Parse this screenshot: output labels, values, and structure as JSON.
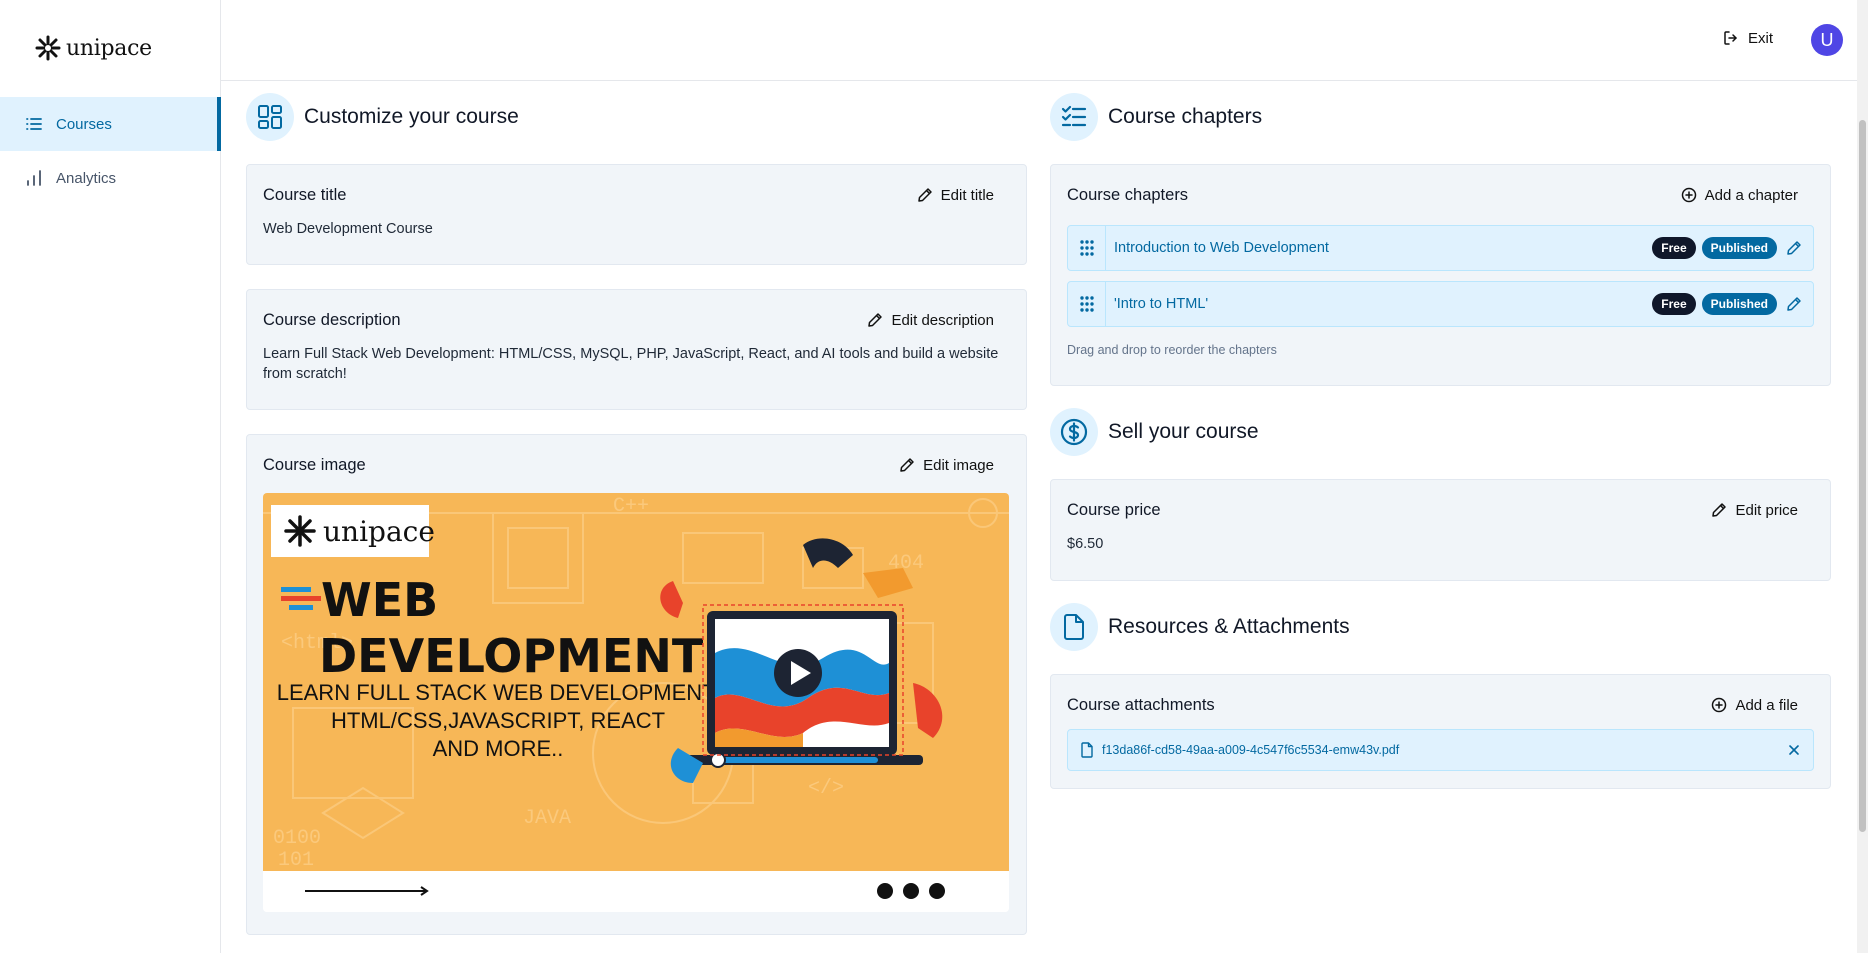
{
  "brand": {
    "name": "unipace"
  },
  "sidebar": {
    "items": [
      {
        "label": "Courses",
        "icon": "list-icon",
        "active": true
      },
      {
        "label": "Analytics",
        "icon": "bar-chart-icon",
        "active": false
      }
    ]
  },
  "topbar": {
    "exit_label": "Exit",
    "avatar_initial": "U"
  },
  "customize": {
    "section_title": "Customize your course",
    "title_card": {
      "label": "Course title",
      "action": "Edit title",
      "value": "Web Development Course"
    },
    "description_card": {
      "label": "Course description",
      "action": "Edit description",
      "value": "Learn Full Stack Web Development: HTML/CSS, MySQL, PHP, JavaScript, React, and AI tools and build a website from scratch!"
    },
    "image_card": {
      "label": "Course image",
      "action": "Edit image",
      "image": {
        "logo_text": "unipace",
        "headline_1": "WEB",
        "headline_2": "DEVELOPMENT",
        "sub_1": "LEARN FULL STACK WEB DEVELOPMENT:",
        "sub_2": "HTML/CSS,JAVASCRIPT, REACT",
        "sub_3": "AND MORE..",
        "bg_word_1": "C++",
        "bg_word_2": "404",
        "bg_word_3": "<html>",
        "bg_word_4": "JAVA",
        "bg_word_5": "0100",
        "bg_word_6": "101",
        "bg_word_7": "</>"
      }
    }
  },
  "chapters": {
    "section_title": "Course chapters",
    "card_label": "Course chapters",
    "action": "Add a chapter",
    "items": [
      {
        "title": "Introduction to Web Development",
        "free": "Free",
        "status": "Published"
      },
      {
        "title": "'Intro to HTML'",
        "free": "Free",
        "status": "Published"
      }
    ],
    "hint": "Drag and drop to reorder the chapters"
  },
  "sell": {
    "section_title": "Sell your course",
    "card_label": "Course price",
    "action": "Edit price",
    "value": "$6.50"
  },
  "resources": {
    "section_title": "Resources & Attachments",
    "card_label": "Course attachments",
    "action": "Add a file",
    "files": [
      {
        "name": "f13da86f-cd58-49aa-a009-4c547f6c5534-emw43v.pdf"
      }
    ]
  },
  "colors": {
    "accent": "#0369a1",
    "accent_light": "#e0f2fe",
    "banner_orange": "#f7b757"
  }
}
